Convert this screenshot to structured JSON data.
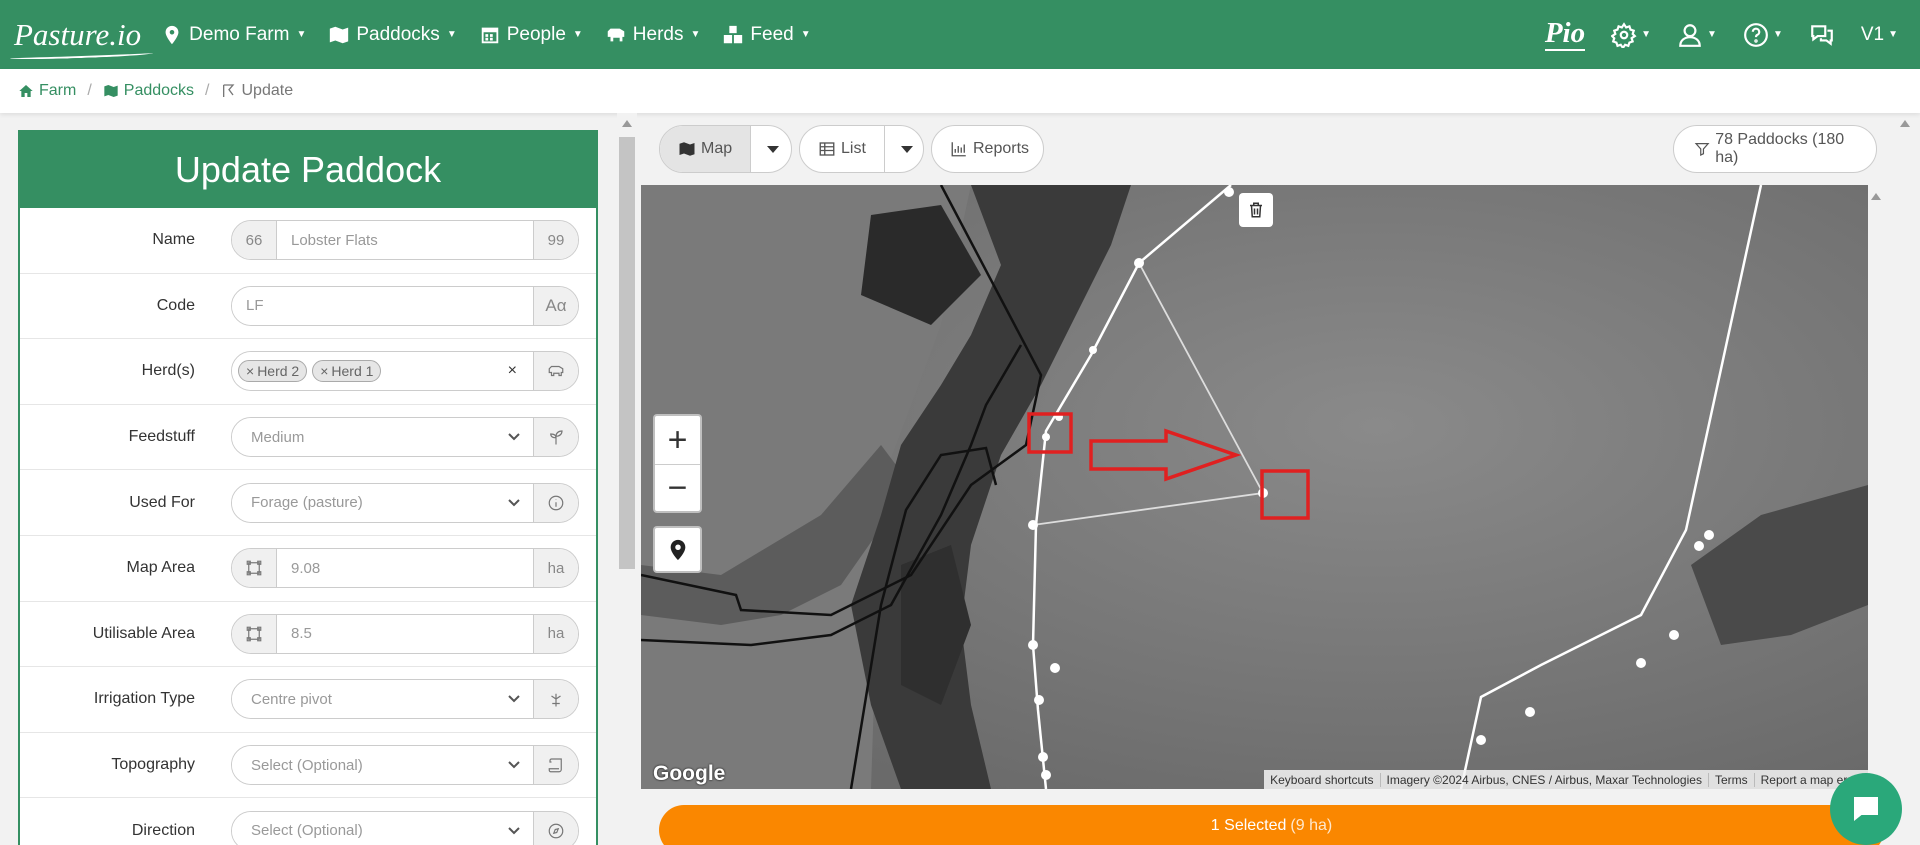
{
  "navbar": {
    "brand": "Pasture.io",
    "farm": "Demo Farm",
    "paddocks": "Paddocks",
    "people": "People",
    "herds": "Herds",
    "feed": "Feed",
    "pio": "Pio",
    "version": "V1"
  },
  "breadcrumb": {
    "farm": "Farm",
    "paddocks": "Paddocks",
    "current": "Update"
  },
  "form": {
    "title": "Update Paddock",
    "name_label": "Name",
    "name_prefix": "66",
    "name_value": "Lobster Flats",
    "name_suffix": "99",
    "code_label": "Code",
    "code_value": "LF",
    "herds_label": "Herd(s)",
    "herd_tags": [
      "Herd 2",
      "Herd 1"
    ],
    "herd_tag_remove": "×",
    "herds_clear": "×",
    "feedstuff_label": "Feedstuff",
    "feedstuff_value": "Medium",
    "used_for_label": "Used For",
    "used_for_value": "Forage (pasture)",
    "map_area_label": "Map Area",
    "map_area_value": "9.08",
    "map_area_unit": "ha",
    "util_area_label": "Utilisable Area",
    "util_area_value": "8.5",
    "util_area_unit": "ha",
    "irrigation_label": "Irrigation Type",
    "irrigation_value": "Centre pivot",
    "topography_label": "Topography",
    "topography_value": "Select (Optional)",
    "direction_label": "Direction",
    "direction_value": "Select (Optional)"
  },
  "toolbar": {
    "map": "Map",
    "list": "List",
    "reports": "Reports",
    "filter": "78 Paddocks (180 ha)"
  },
  "map": {
    "zoom_in": "+",
    "zoom_out": "−",
    "google": "Google",
    "attribution": [
      "Keyboard shortcuts",
      "Imagery ©2024 Airbus, CNES / Airbus, Maxar Technologies",
      "Terms",
      "Report a map error"
    ]
  },
  "selected": {
    "count": "1 Selected",
    "area": "(9 ha)"
  },
  "colors": {
    "brand_green": "#358f62",
    "selected_orange": "#fa8700",
    "annotation_red": "#e02020"
  }
}
